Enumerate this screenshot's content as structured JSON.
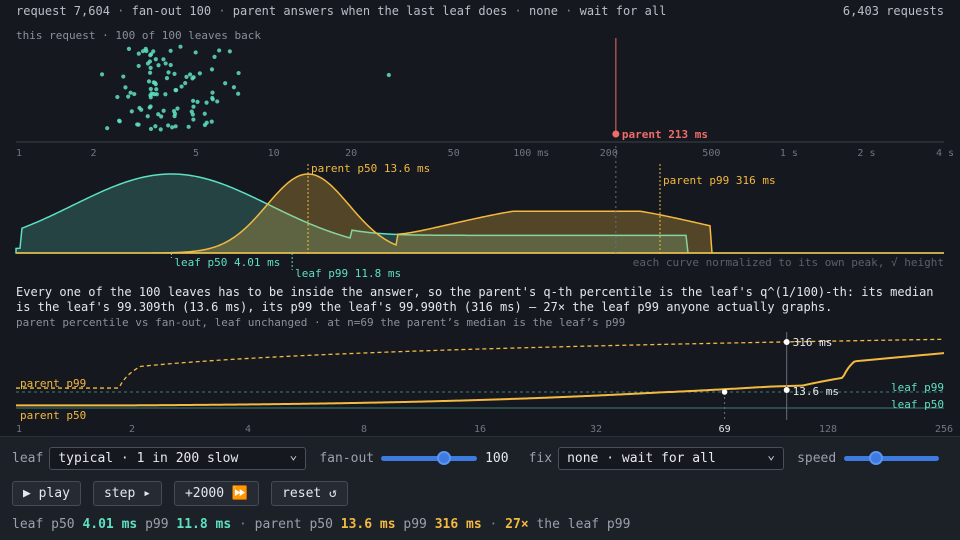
{
  "header": {
    "left_parts": [
      "request 7,604",
      "fan-out 100",
      "parent answers when the last leaf does",
      "none",
      "wait for all"
    ],
    "separator": " · ",
    "right": "6,403 requests"
  },
  "colors": {
    "teal": "#5ee0c2",
    "gold": "#f3b941",
    "red": "#f06b6b",
    "axis": "#6f7582",
    "bg": "#15181e",
    "panel": "#1c2027"
  },
  "top_panel": {
    "label": "this request · 100 of 100 leaves back",
    "parent_marker_label": "parent 213 ms",
    "parent_latency_ms": 213,
    "x_ticks": [
      {
        "v": 1,
        "label": "1"
      },
      {
        "v": 2,
        "label": "2"
      },
      {
        "v": 5,
        "label": "5"
      },
      {
        "v": 10,
        "label": "10"
      },
      {
        "v": 20,
        "label": "20"
      },
      {
        "v": 50,
        "label": "50"
      },
      {
        "v": 100,
        "label": "100 ms"
      },
      {
        "v": 200,
        "label": "200"
      },
      {
        "v": 500,
        "label": "500"
      },
      {
        "v": 1000,
        "label": "1 s"
      },
      {
        "v": 2000,
        "label": "2 s"
      },
      {
        "v": 4000,
        "label": "4 s"
      }
    ],
    "x_range_ms": [
      1,
      4000
    ]
  },
  "distribution": {
    "leaf_p50_label": "leaf p50 4.01 ms",
    "leaf_p99_label": "leaf p99 11.8 ms",
    "parent_p50_label": "parent p50 13.6 ms",
    "parent_p99_label": "parent p99 316 ms",
    "leaf_p50_ms": 4.01,
    "leaf_p99_ms": 11.8,
    "parent_p50_ms": 13.6,
    "parent_p99_ms": 316,
    "note": "each curve normalized to its own peak, √ height"
  },
  "explanation": "Every one of the 100 leaves has to be inside the answer, so the parent's q-th percentile is the leaf's q^(1/100)-th: its median is the leaf's 99.309th (13.6 ms), its p99 the leaf's 99.990th (316 ms) — 27× the leaf p99 anyone actually graphs.",
  "fanout_chart": {
    "caption": "parent percentile vs fan-out, leaf unchanged · at n=69 the parent’s median is the leaf’s p99",
    "x_ticks": [
      1,
      2,
      4,
      8,
      16,
      32,
      69,
      128,
      256
    ],
    "x_tick_labels": [
      "1",
      "2",
      "4",
      "8",
      "16",
      "32",
      "69",
      "128",
      "256"
    ],
    "highlight_n": 69,
    "current_n": 100,
    "labels": {
      "parent_p99": "parent p99",
      "parent_p50": "parent p50",
      "leaf_p99": "leaf p99",
      "leaf_p50": "leaf p50",
      "cur_p99": "316 ms",
      "cur_p50": "13.6 ms"
    }
  },
  "controls": {
    "leaf_label": "leaf",
    "leaf_value": "typical · 1 in 200 slow",
    "fanout_label": "fan-out",
    "fanout_value": "100",
    "fanout_fraction": 0.68,
    "fix_label": "fix",
    "fix_value": "none · wait for all",
    "speed_label": "speed",
    "speed_fraction": 0.3,
    "buttons": {
      "play": "▶ play",
      "step": "step ▸",
      "plus": "+2000 ⏩",
      "reset": "reset ↺"
    }
  },
  "summary": {
    "leaf_p50_label": "leaf p50",
    "leaf_p50": "4.01 ms",
    "p99_label": "p99",
    "leaf_p99": "11.8 ms",
    "parent_p50_label": "parent p50",
    "parent_p50": "13.6 ms",
    "parent_p99": "316 ms",
    "ratio": "27×",
    "ratio_suffix": "the leaf p99"
  }
}
